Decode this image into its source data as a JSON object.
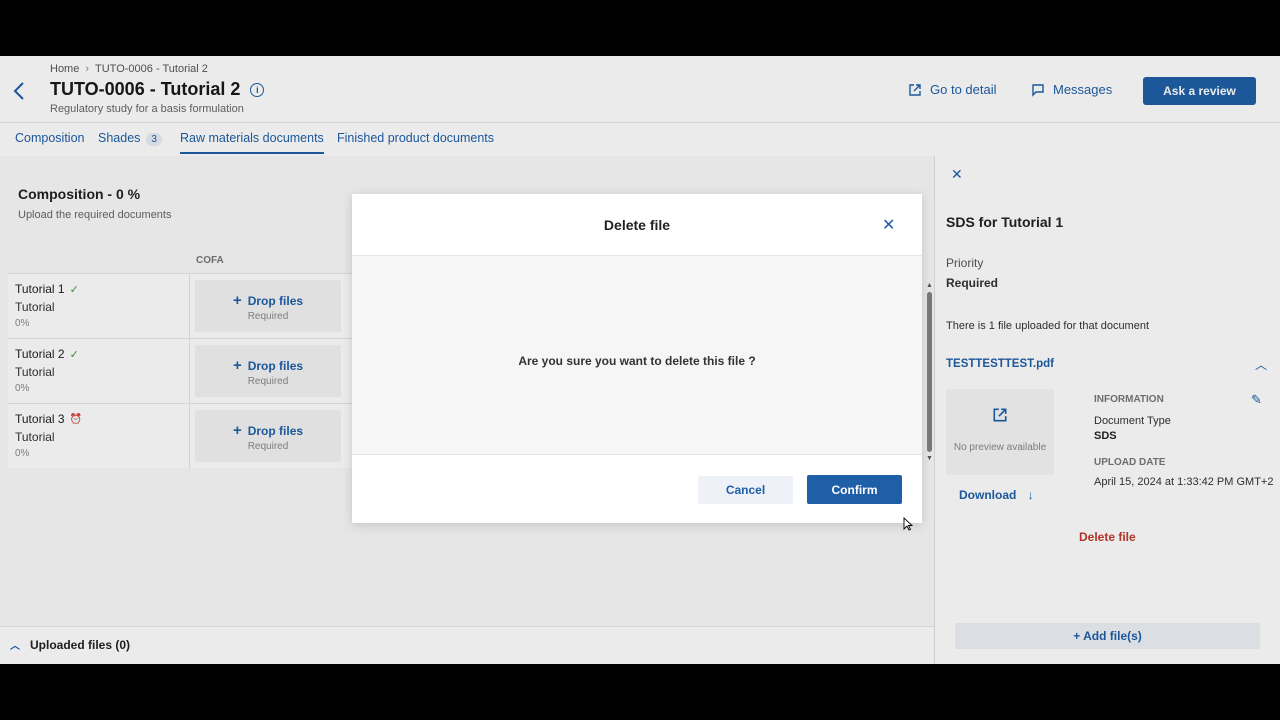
{
  "header": {
    "breadcrumb": [
      "Home",
      "TUTO-0006 - Tutorial 2"
    ],
    "title": "TUTO-0006 - Tutorial 2",
    "subtitle": "Regulatory study for a basis formulation",
    "go_to_detail": "Go to detail",
    "messages": "Messages",
    "ask_review": "Ask a review"
  },
  "tabs": [
    {
      "label": "Composition"
    },
    {
      "label": "Shades",
      "badge": "3"
    },
    {
      "label": "Raw materials documents",
      "active": true
    },
    {
      "label": "Finished product documents"
    }
  ],
  "main": {
    "title": "Composition - 0 %",
    "subtitle": "Upload the required documents",
    "column_header": "COFA",
    "rows": [
      {
        "name": "Tutorial 1",
        "type": "Tutorial",
        "percent": "0%",
        "status": "check",
        "drop": "Drop files",
        "drop_sub": "Required"
      },
      {
        "name": "Tutorial 2",
        "type": "Tutorial",
        "percent": "0%",
        "status": "check",
        "drop": "Drop files",
        "drop_sub": "Required"
      },
      {
        "name": "Tutorial 3",
        "type": "Tutorial",
        "percent": "0%",
        "status": "clock",
        "drop": "Drop files",
        "drop_sub": "Required"
      }
    ],
    "uploaded_files": "Uploaded files (0)"
  },
  "panel": {
    "title": "SDS for Tutorial 1",
    "priority_label": "Priority",
    "priority_value": "Required",
    "file_count_text": "There is 1 file uploaded for that document",
    "file_name": "TESTTESTTEST.pdf",
    "no_preview": "No preview available",
    "information_label": "INFORMATION",
    "doc_type_label": "Document Type",
    "doc_type_value": "SDS",
    "upload_date_label": "UPLOAD DATE",
    "upload_date_value": "April 15, 2024 at 1:33:42 PM GMT+2",
    "download": "Download",
    "delete_file": "Delete file",
    "add_files": "+ Add file(s)"
  },
  "modal": {
    "title": "Delete file",
    "message": "Are you sure you want to delete this file ?",
    "cancel": "Cancel",
    "confirm": "Confirm"
  },
  "colors": {
    "accent": "#1f5fa8",
    "danger": "#c0392b",
    "success": "#3a9a3a"
  }
}
